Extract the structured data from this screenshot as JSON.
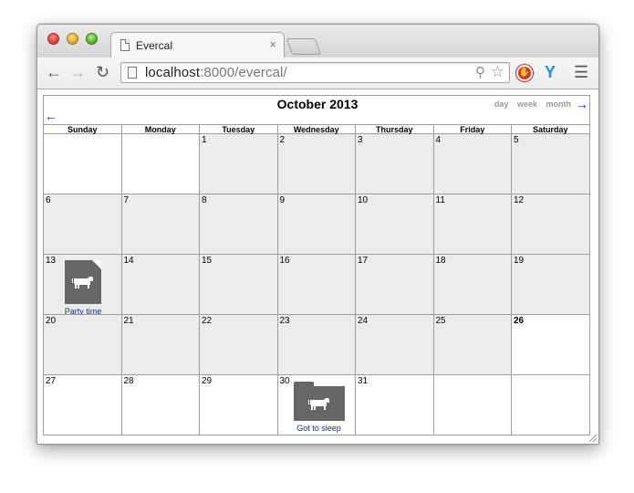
{
  "browser": {
    "tab_title": "Evercal",
    "tab_close": "×",
    "url_host": "localhost",
    "url_rest": ":8000/evercal/",
    "nav_back": "←",
    "nav_forward": "→",
    "nav_reload": "↻",
    "menu": "☰"
  },
  "calendar": {
    "title": "October 2013",
    "prev_arrow": "←",
    "next_arrow": "→",
    "views": [
      "day",
      "week",
      "month"
    ],
    "weekdays": [
      "Sunday",
      "Monday",
      "Tuesday",
      "Wednesday",
      "Thursday",
      "Friday",
      "Saturday"
    ],
    "weeks": [
      [
        "",
        "",
        "1",
        "2",
        "3",
        "4",
        "5"
      ],
      [
        "6",
        "7",
        "8",
        "9",
        "10",
        "11",
        "12"
      ],
      [
        "13",
        "14",
        "15",
        "16",
        "17",
        "18",
        "19"
      ],
      [
        "20",
        "21",
        "22",
        "23",
        "24",
        "25",
        "26"
      ],
      [
        "27",
        "28",
        "29",
        "30",
        "31",
        "",
        ""
      ]
    ],
    "today": "26",
    "events": [
      {
        "day": "13",
        "label": "Party time",
        "icon": "cow-note-icon"
      },
      {
        "day": "30",
        "label": "Got to sleep",
        "icon": "cow-notebook-icon"
      }
    ]
  },
  "colors": {
    "past_day_bg": "#ececec",
    "future_day_bg": "#ffffff",
    "event_icon_bg": "#666666",
    "link_color": "#1a2aa8"
  }
}
